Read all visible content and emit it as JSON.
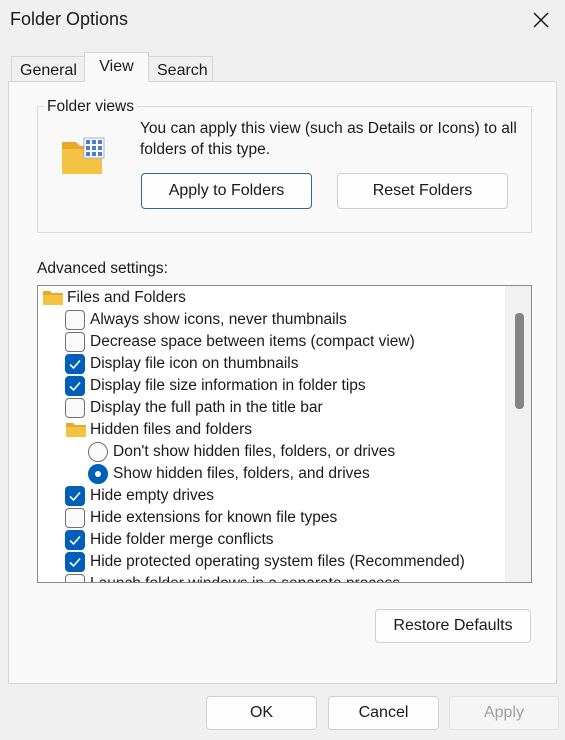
{
  "window": {
    "title": "Folder Options"
  },
  "tabs": [
    {
      "label": "General"
    },
    {
      "label": "View"
    },
    {
      "label": "Search"
    }
  ],
  "folder_views": {
    "legend": "Folder views",
    "description": "You can apply this view (such as Details or Icons) to all folders of this type.",
    "apply_label": "Apply to Folders",
    "reset_label": "Reset Folders"
  },
  "advanced": {
    "label": "Advanced settings:",
    "items": [
      {
        "type": "folder",
        "label": "Files and Folders"
      },
      {
        "type": "checkbox",
        "label": "Always show icons, never thumbnails",
        "checked": false
      },
      {
        "type": "checkbox",
        "label": "Decrease space between items (compact view)",
        "checked": false
      },
      {
        "type": "checkbox",
        "label": "Display file icon on thumbnails",
        "checked": true
      },
      {
        "type": "checkbox",
        "label": "Display file size information in folder tips",
        "checked": true
      },
      {
        "type": "checkbox",
        "label": "Display the full path in the title bar",
        "checked": false
      },
      {
        "type": "folder",
        "label": "Hidden files and folders"
      },
      {
        "type": "radio",
        "label": "Don't show hidden files, folders, or drives",
        "checked": false
      },
      {
        "type": "radio",
        "label": "Show hidden files, folders, and drives",
        "checked": true
      },
      {
        "type": "checkbox",
        "label": "Hide empty drives",
        "checked": true
      },
      {
        "type": "checkbox",
        "label": "Hide extensions for known file types",
        "checked": false
      },
      {
        "type": "checkbox",
        "label": "Hide folder merge conflicts",
        "checked": true
      },
      {
        "type": "checkbox",
        "label": "Hide protected operating system files (Recommended)",
        "checked": true
      },
      {
        "type": "checkbox",
        "label": "Launch folder windows in a separate process",
        "checked": false
      }
    ],
    "restore_label": "Restore Defaults"
  },
  "footer": {
    "ok_label": "OK",
    "cancel_label": "Cancel",
    "apply_label": "Apply"
  },
  "colors": {
    "accent": "#005fb8",
    "folder": "#f5c344"
  },
  "icons": {
    "close": "close-icon",
    "folder": "folder-icon",
    "checkmark": "checkmark-icon"
  }
}
